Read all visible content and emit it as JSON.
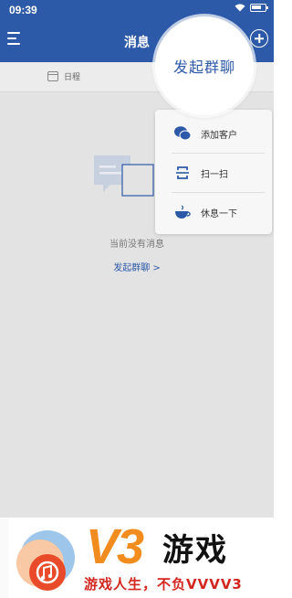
{
  "status_bar": {
    "time": "09:39",
    "battery_level": 0.8
  },
  "nav": {
    "title": "消息"
  },
  "tabs": {
    "schedule_label": "日程"
  },
  "empty_state": {
    "message": "当前没有消息",
    "link": "发起群聊 >"
  },
  "popup_menu": {
    "highlight_label": "发起群聊",
    "items": [
      {
        "label": "添加客户",
        "icon": "wechat-icon"
      },
      {
        "label": "扫一扫",
        "icon": "scan-icon"
      },
      {
        "label": "休息一下",
        "icon": "coffee-cup-icon"
      }
    ]
  },
  "watermark": {
    "brand": "V3",
    "brand_cn": "游戏",
    "slogan": "游戏人生，不负VVVV3"
  },
  "colors": {
    "primary": "#2d5aa8",
    "accent_orange": "#f28c1e",
    "accent_red": "#d2261f"
  }
}
